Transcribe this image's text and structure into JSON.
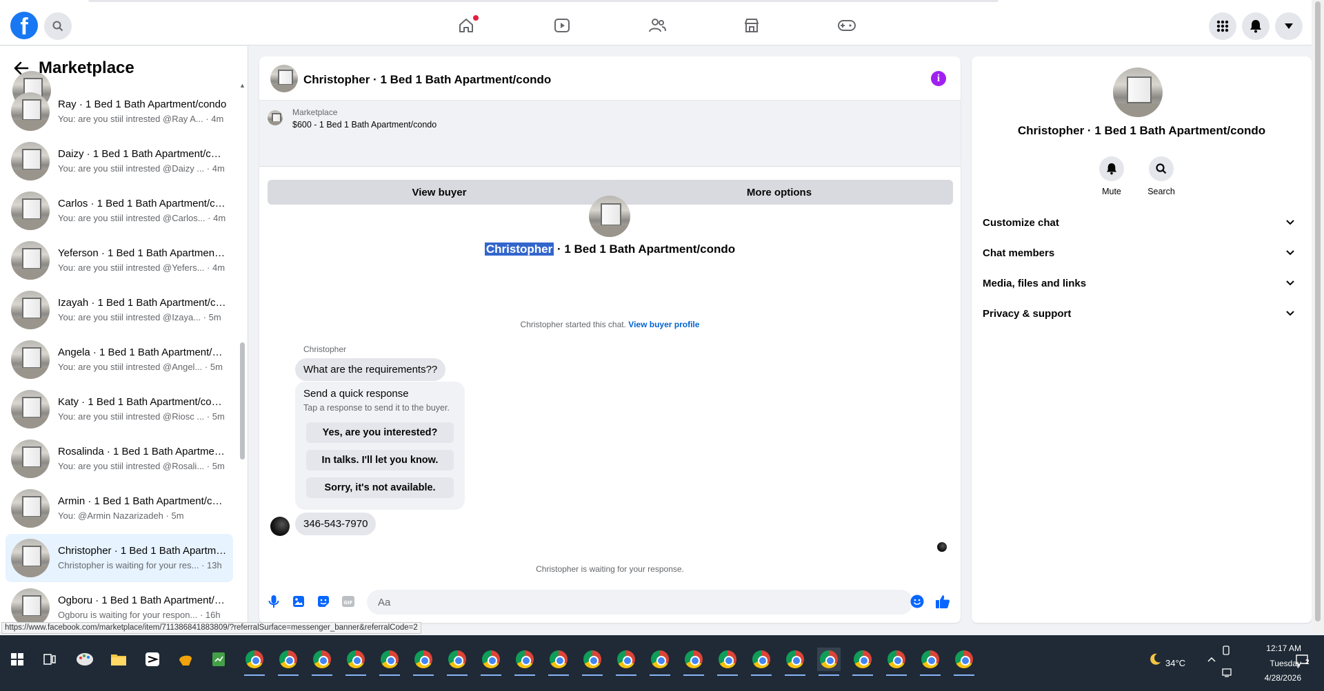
{
  "topnav": {
    "logo": "f",
    "icons": [
      "home-icon",
      "video-icon",
      "friends-icon",
      "marketplace-icon",
      "gaming-icon"
    ]
  },
  "sidebar": {
    "title": "Marketplace",
    "conversations": [
      {
        "name": "Ray · 1 Bed 1 Bath Apartment/condo",
        "preview": "You: are you stiil intrested @Ray A...",
        "time": "4m",
        "active": false
      },
      {
        "name": "Daizy · 1 Bed 1 Bath Apartment/condo",
        "preview": "You: are you stiil intrested @Daizy ...",
        "time": "4m",
        "active": false
      },
      {
        "name": "Carlos · 1 Bed 1 Bath Apartment/condo",
        "preview": "You: are you stiil intrested @Carlos...",
        "time": "4m",
        "active": false
      },
      {
        "name": "Yeferson · 1 Bed 1 Bath Apartment/condo",
        "preview": "You: are you stiil intrested @Yefers...",
        "time": "4m",
        "active": false
      },
      {
        "name": "Izayah · 1 Bed 1 Bath Apartment/condo",
        "preview": "You: are you stiil intrested @Izaya...",
        "time": "5m",
        "active": false
      },
      {
        "name": "Angela · 1 Bed 1 Bath Apartment/condo",
        "preview": "You: are you stiil intrested @Angel...",
        "time": "5m",
        "active": false
      },
      {
        "name": "Katy · 1 Bed 1 Bath Apartment/condo",
        "preview": "You: are you stiil intrested @Riosc ...",
        "time": "5m",
        "active": false
      },
      {
        "name": "Rosalinda · 1 Bed 1 Bath Apartment/condo",
        "preview": "You: are you stiil intrested @Rosali...",
        "time": "5m",
        "active": false
      },
      {
        "name": "Armin · 1 Bed 1 Bath Apartment/condo",
        "preview": "You: @Armin Nazarizadeh",
        "time": "5m",
        "active": false
      },
      {
        "name": "Christopher · 1 Bed 1 Bath Apartment/condo",
        "preview": "Christopher is waiting for your res...",
        "time": "13h",
        "active": true
      },
      {
        "name": "Ogboru · 1 Bed 1 Bath Apartment/condo",
        "preview": "Ogboru is waiting for your respon...",
        "time": "16h",
        "active": false
      }
    ]
  },
  "chat": {
    "header_title": "Christopher · 1 Bed 1 Bath Apartment/condo",
    "banner": {
      "label": "Marketplace",
      "listing": "$600 - 1 Bed 1 Bath Apartment/condo"
    },
    "view_buyer": "View buyer",
    "more_options": "More options",
    "intro_name_highlight": "Christopher",
    "intro_name_rest": "· 1 Bed 1 Bath Apartment/condo",
    "started_text": "Christopher started this chat.",
    "view_buyer_profile": "View buyer profile",
    "sender": "Christopher",
    "message1": "What are the requirements??",
    "quick_response_title": "Send a quick response",
    "quick_response_sub": "Tap a response to send it to the buyer.",
    "quick_responses": [
      "Yes, are you interested?",
      "In talks. I'll let you know.",
      "Sorry, it's not available."
    ],
    "message2": "346-543-7970",
    "waiting_text": "Christopher is waiting for your response.",
    "composer_placeholder": "Aa"
  },
  "right_panel": {
    "name": "Christopher · 1 Bed 1 Bath Apartment/condo",
    "mute_label": "Mute",
    "search_label": "Search",
    "sections": [
      "Customize chat",
      "Chat members",
      "Media, files and links",
      "Privacy & support"
    ]
  },
  "status_url": "https://www.facebook.com/marketplace/item/711386841883809/?referralSurface=messenger_banner&referralCode=2",
  "taskbar": {
    "weather": "34°C",
    "time": "12:17 AM",
    "day": "Tuesday",
    "date": "4/28/2026",
    "notif_count": "2"
  },
  "colors": {
    "accent": "#1877f2",
    "active_row": "#e7f3ff",
    "info": "#a020f0",
    "highlight": "#3366cc"
  }
}
